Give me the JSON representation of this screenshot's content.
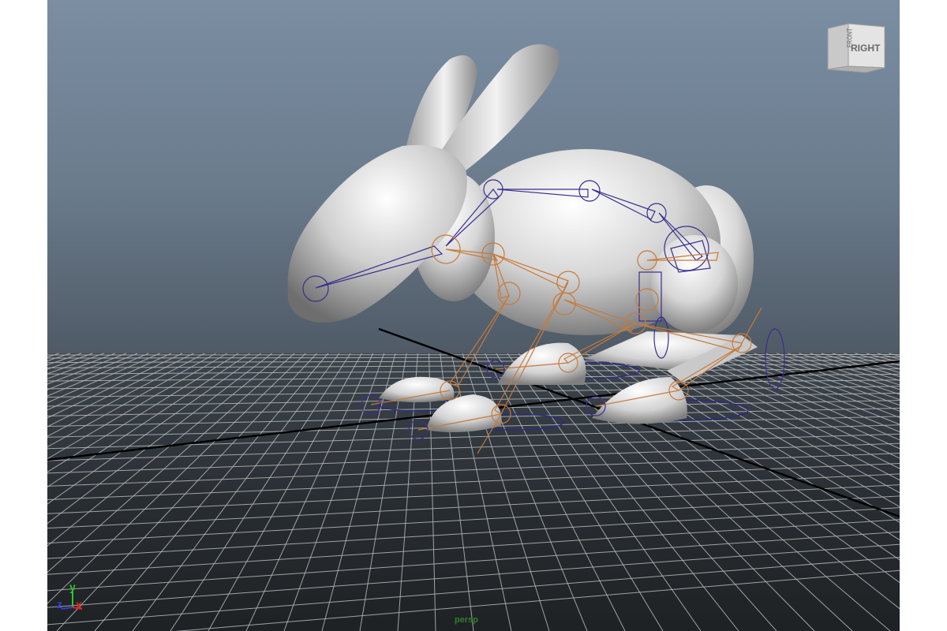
{
  "viewport": {
    "camera_name": "persp",
    "background_top": "#7b8ea2",
    "background_bottom": "#202224",
    "grid_color": "#b8b8b8",
    "grid_axis_color": "#000000"
  },
  "view_cube": {
    "front_label": "FRONT",
    "right_label": "RIGHT",
    "icon": "view-cube-icon"
  },
  "axis_triad": {
    "y": "y",
    "z": "z",
    "x": "x",
    "y_color": "#2fc72f",
    "z_color": "#3a3ad8",
    "x_color": "#e02424"
  },
  "rig_colors": {
    "spine": "#3a2e8f",
    "legs": "#c77a3a",
    "controls": "#2a2a8a"
  }
}
